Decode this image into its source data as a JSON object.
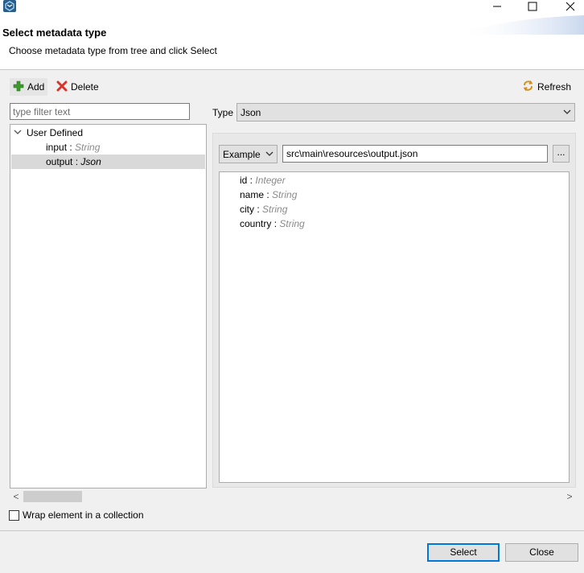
{
  "window": {
    "icon": "app-logo-icon",
    "controls": [
      "minimize-icon",
      "maximize-icon",
      "close-icon"
    ]
  },
  "header": {
    "title": "Select metadata type",
    "description": "Choose metadata type from tree and click Select"
  },
  "toolbar": {
    "add_label": "Add",
    "delete_label": "Delete",
    "refresh_label": "Refresh"
  },
  "filter": {
    "placeholder": "type filter text",
    "value": ""
  },
  "tree": {
    "root_label": "User Defined",
    "items": [
      {
        "name": "input",
        "separator": " : ",
        "type": "String",
        "selected": false
      },
      {
        "name": "output",
        "separator": " : ",
        "type": "Json",
        "selected": true
      }
    ]
  },
  "type_row": {
    "label": "Type",
    "selected": "Json"
  },
  "example": {
    "mode": "Example",
    "path": "src\\main\\resources\\output.json",
    "browse_label": "..."
  },
  "fields": [
    {
      "name": "id",
      "separator": " : ",
      "type": "Integer"
    },
    {
      "name": "name",
      "separator": " : ",
      "type": "String"
    },
    {
      "name": "city",
      "separator": " : ",
      "type": "String"
    },
    {
      "name": "country",
      "separator": " : ",
      "type": "String"
    }
  ],
  "scroll": {
    "left_arrow": "<",
    "right_arrow": ">"
  },
  "options": {
    "wrap_label": "Wrap element in a collection",
    "wrap_checked": false
  },
  "footer": {
    "select_label": "Select",
    "close_label": "Close"
  },
  "colors": {
    "accent": "#0078d7",
    "add_icon": "#3c9a2c",
    "delete_icon": "#d9342b",
    "refresh_icon": "#d98a10"
  }
}
